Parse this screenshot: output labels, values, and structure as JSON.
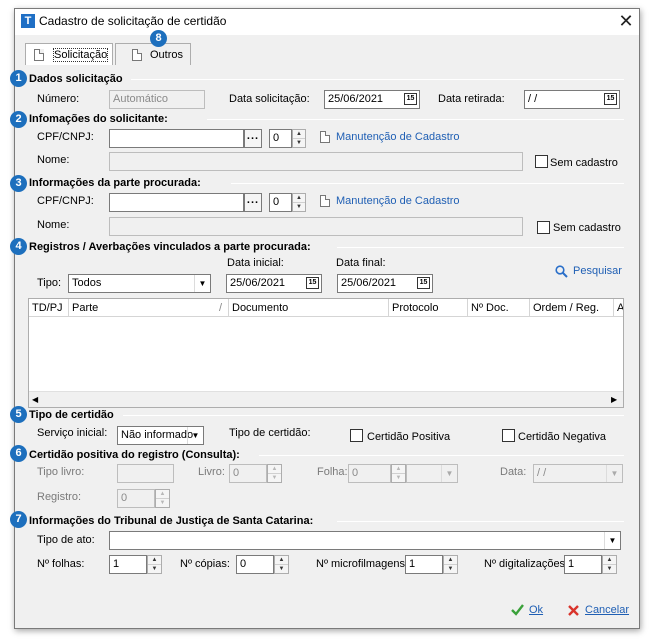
{
  "window": {
    "title": "Cadastro de solicitação de certidão",
    "app_icon": "T"
  },
  "tabs": [
    {
      "label": "Solicitação",
      "active": true
    },
    {
      "label": "Outros",
      "active": false
    }
  ],
  "badges": [
    "1",
    "2",
    "3",
    "4",
    "5",
    "6",
    "7",
    "8"
  ],
  "dados": {
    "title": "Dados solicitação",
    "numero_label": "Número:",
    "numero_value": "Automático",
    "data_solicitacao_label": "Data solicitação:",
    "data_solicitacao_value": "25/06/2021",
    "data_retirada_label": "Data retirada:",
    "data_retirada_value": " /  /"
  },
  "solicitante": {
    "title": "Infomações do solicitante:",
    "cpf_label": "CPF/CNPJ:",
    "cpf_value": "",
    "dots": "...",
    "spin_value": "0",
    "link": "Manutenção de Cadastro",
    "nome_label": "Nome:",
    "sem_cadastro": "Sem cadastro"
  },
  "parte": {
    "title": "Informações da parte procurada:",
    "cpf_label": "CPF/CNPJ:",
    "dots": "...",
    "spin_value": "0",
    "link": "Manutenção de Cadastro",
    "nome_label": "Nome:",
    "sem_cadastro": "Sem cadastro"
  },
  "registros": {
    "title": "Registros / Averbações vinculados a parte procurada:",
    "tipo_label": "Tipo:",
    "tipo_value": "Todos",
    "data_inicial_label": "Data inicial:",
    "data_inicial_value": "25/06/2021",
    "data_final_label": "Data final:",
    "data_final_value": "25/06/2021",
    "pesquisar": "Pesquisar",
    "columns": [
      "TD/PJ",
      "Parte",
      "Documento",
      "Protocolo",
      "Nº Doc.",
      "Ordem / Reg.",
      "A"
    ]
  },
  "tipo_certidao": {
    "title": "Tipo de certidão",
    "servico_label": "Serviço inicial:",
    "servico_value": "Não informado",
    "tipo_label": "Tipo de certidão:",
    "positiva": "Certidão Positiva",
    "negativa": "Certidão Negativa"
  },
  "positiva": {
    "title": "Certidão positiva do registro (Consulta):",
    "tipo_livro_label": "Tipo livro:",
    "livro_label": "Livro:",
    "livro_value": "0",
    "folha_label": "Folha:",
    "folha_value": "0",
    "data_label": "Data:",
    "data_value": " /  /",
    "registro_label": "Registro:",
    "registro_value": "0"
  },
  "tribunal": {
    "title": "Informações do Tribunal de Justiça de Santa Catarina:",
    "tipo_ato_label": "Tipo de ato:",
    "folhas_label": "Nº folhas:",
    "folhas_value": "1",
    "copias_label": "Nº cópias:",
    "copias_value": "0",
    "microfilmagens_label": "Nº microfilmagens:",
    "microfilmagens_value": "1",
    "digitalizacoes_label": "Nº digitalizações:",
    "digitalizacoes_value": "1"
  },
  "footer": {
    "ok": "Ok",
    "cancelar": "Cancelar"
  },
  "colors": {
    "badge": "#1d6fbd",
    "link": "#1f5fb4",
    "ok": "#3aa13a",
    "cancel": "#d9342b"
  }
}
